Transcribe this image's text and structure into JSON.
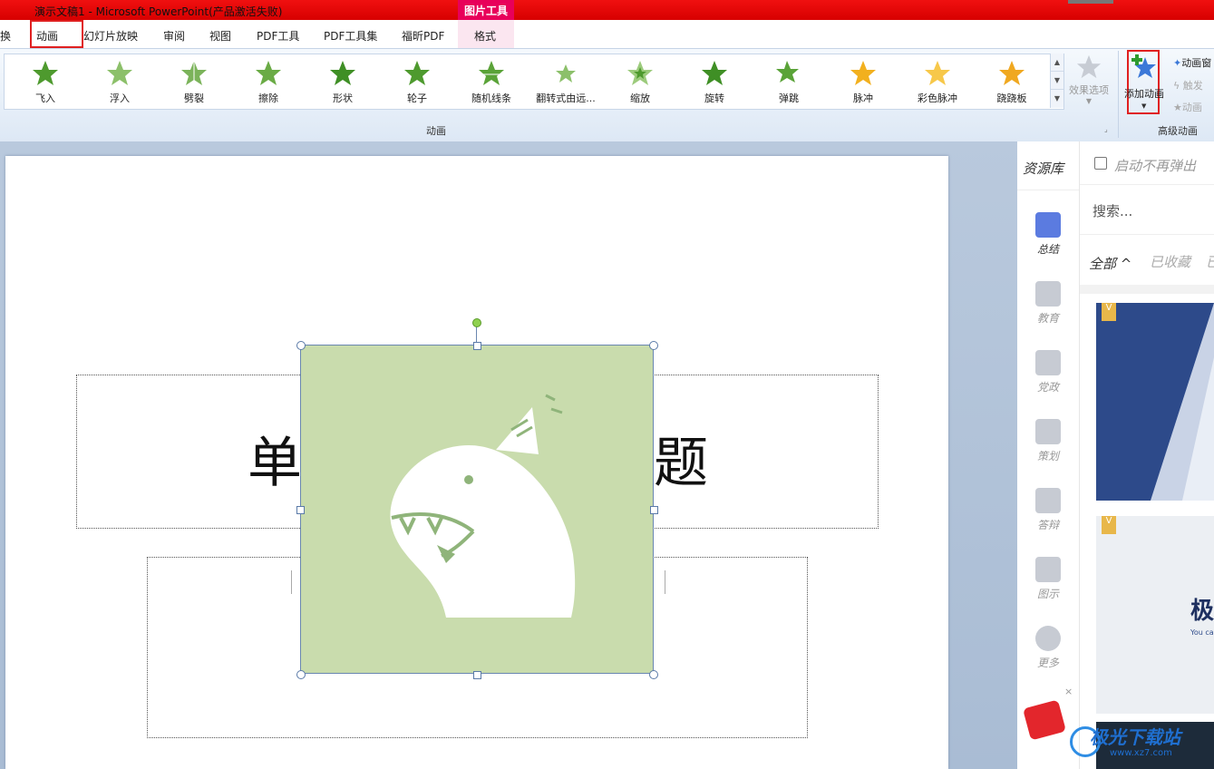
{
  "window": {
    "title": "演示文稿1 - Microsoft PowerPoint(产品激活失败)",
    "context_tab_group": "图片工具"
  },
  "tabs": [
    "换",
    "动画",
    "幻灯片放映",
    "审阅",
    "视图",
    "PDF工具",
    "PDF工具集",
    "福昕PDF",
    "格式"
  ],
  "ribbon": {
    "animations": [
      "飞入",
      "浮入",
      "劈裂",
      "擦除",
      "形状",
      "轮子",
      "随机线条",
      "翻转式由远...",
      "缩放",
      "旋转",
      "弹跳",
      "脉冲",
      "彩色脉冲",
      "跷跷板"
    ],
    "effect_options": "效果选项",
    "group_animation": "动画",
    "add_animation": "添加动画",
    "animation_pane": "动画窗",
    "trigger": "触发",
    "animation_painter": "动画",
    "group_advanced": "高级动画"
  },
  "slide": {
    "title_left": "单",
    "title_right": "题"
  },
  "resource_panel": {
    "header": "资源库",
    "no_popup": "启动不再弹出",
    "search_placeholder": "搜索...",
    "filter_all": "全部",
    "filter_fav": "已收藏",
    "filter_more": "已",
    "nav": [
      "总结",
      "教育",
      "党政",
      "策划",
      "答辩",
      "图示",
      "更多"
    ],
    "badge": "V",
    "thumb2_text": "极",
    "thumb2_sub": "You ca"
  },
  "watermark": {
    "site": "极光下载站",
    "url": "www.xz7.com"
  },
  "colors": {
    "title_bar": "#e00000",
    "highlight_box": "#e02020",
    "picture_bg": "#c9dcad",
    "star_green": "#4e9a2e",
    "star_gold": "#f2b01e"
  }
}
